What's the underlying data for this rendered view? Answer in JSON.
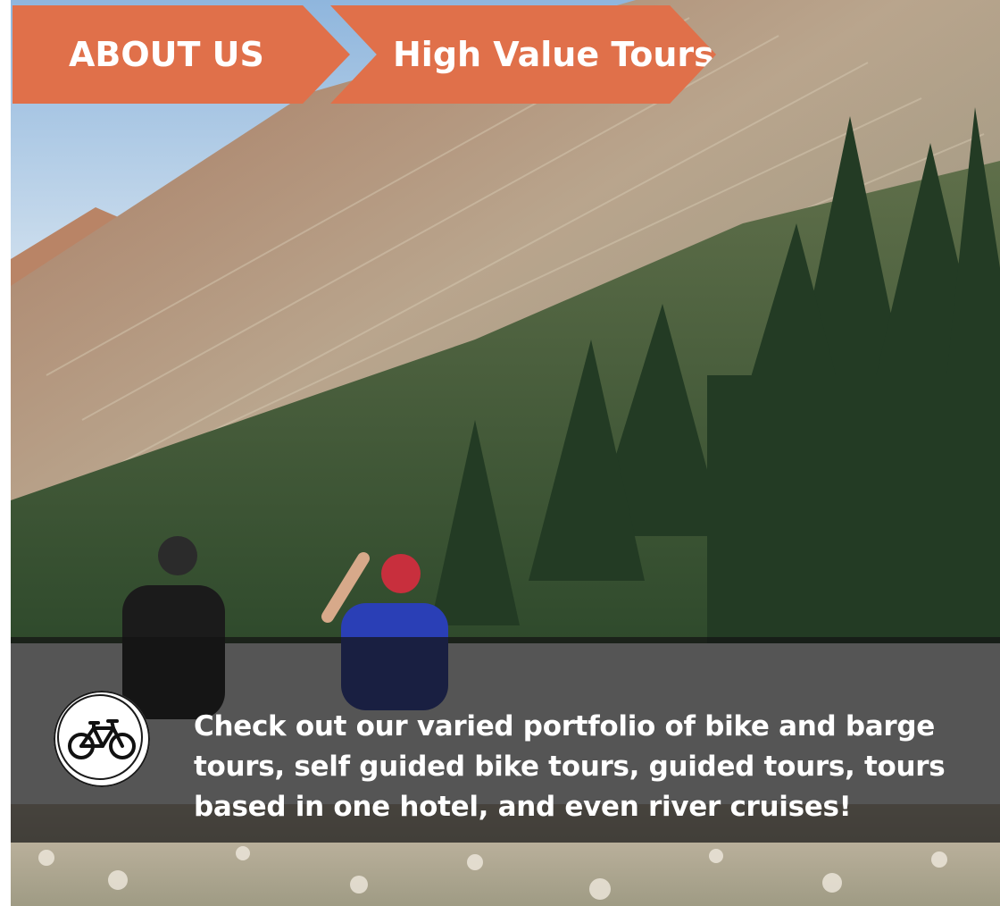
{
  "breadcrumb": {
    "items": [
      {
        "label": "ABOUT US"
      },
      {
        "label": "High Value Tours"
      }
    ]
  },
  "hero": {
    "tagline": "Check out our varied portfolio of bike and barge tours, self guided bike tours, guided tours, tours based in one hotel, and even river cruises!",
    "badge_icon": "bicycle-icon"
  },
  "colors": {
    "breadcrumb_bg": "#e0704a",
    "overlay_bg": "#141414",
    "text": "#ffffff"
  }
}
